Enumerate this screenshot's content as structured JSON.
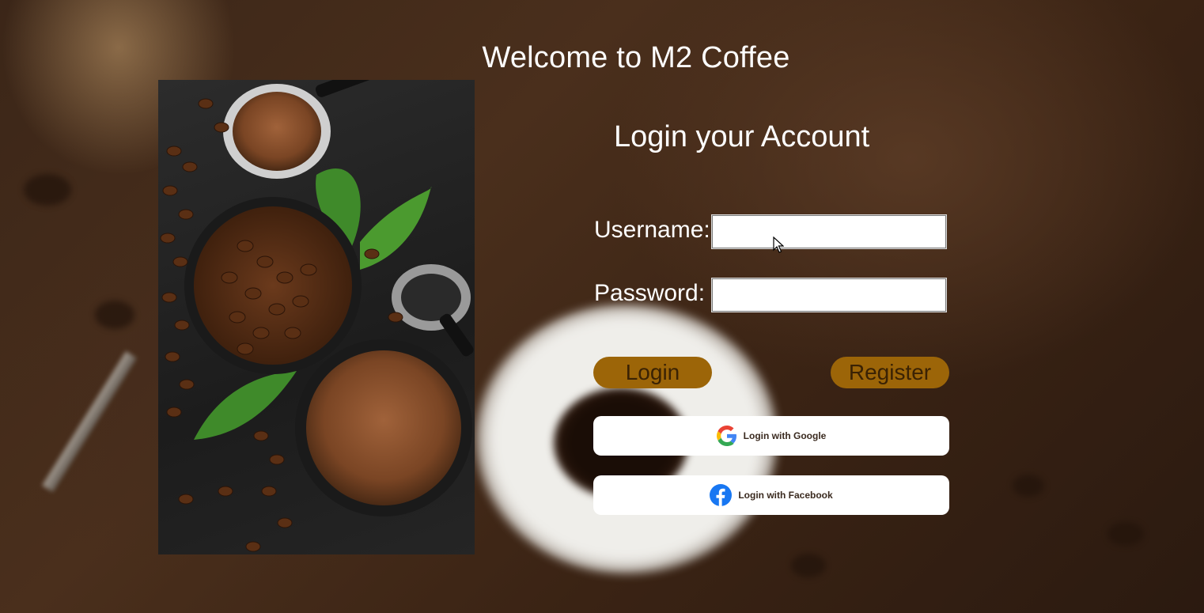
{
  "page": {
    "welcome": "Welcome to M2 Coffee"
  },
  "login": {
    "title": "Login your Account",
    "username_label": "Username:",
    "username_value": "",
    "password_label": "Password:",
    "password_value": "",
    "login_button": "Login",
    "register_button": "Register",
    "google_button": "Login with Google",
    "facebook_button": "Login with Facebook"
  },
  "icons": {
    "google": "google-icon",
    "facebook": "facebook-icon"
  },
  "colors": {
    "button_gold": "#9c6508",
    "button_text": "#3a2204",
    "facebook_blue": "#1877f2"
  }
}
